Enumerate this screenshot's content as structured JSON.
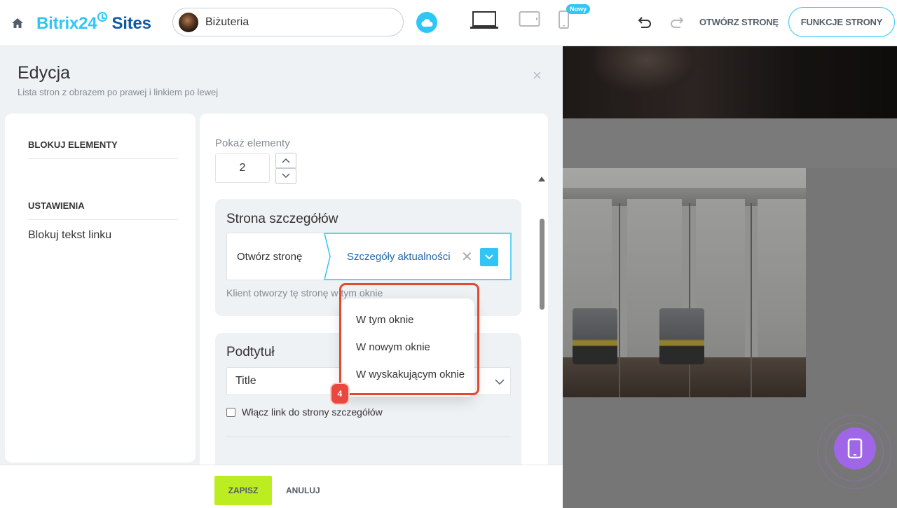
{
  "header": {
    "logo_part1": "Bitrix24",
    "logo_part2": "Sites",
    "site_name": "Biżuteria",
    "new_badge": "Nowy",
    "open_page": "OTWÓRZ STRONĘ",
    "page_functions": "FUNKCJE STRONY"
  },
  "panel": {
    "title": "Edycja",
    "subtitle": "Lista stron z obrazem po prawej i linkiem po lewej",
    "close": "×"
  },
  "sidebar": {
    "section1": "BLOKUJ ELEMENTY",
    "section2": "USTAWIENIA",
    "items": [
      {
        "label": "Blokuj tekst linku"
      }
    ]
  },
  "form": {
    "show_elements_label": "Pokaż elementy",
    "show_elements_value": "2",
    "detail_card": {
      "title": "Strona szczegółów",
      "action_label": "Otwórz stronę",
      "page_value": "Szczegóły aktualności",
      "hint": "Klient otworzy tę stronę w tym oknie"
    },
    "subtitle_card": {
      "title": "Podtytuł",
      "select_value": "Title",
      "checkbox_label": "Włącz link do strony szczegółów"
    }
  },
  "dropdown": {
    "options": [
      {
        "label": "W tym oknie"
      },
      {
        "label": "W nowym oknie"
      },
      {
        "label": "W wyskakującym oknie"
      }
    ]
  },
  "annotation": {
    "step_number": "4",
    "color": "#e04a2f"
  },
  "footer": {
    "save": "ZAPISZ",
    "cancel": "ANULUJ"
  },
  "colors": {
    "accent": "#2fc6f6",
    "brand_dark": "#0f58a8",
    "save_green": "#bbed21",
    "fab_purple": "#9f66e8"
  },
  "icons": {
    "home": "home-icon",
    "cloud": "cloud-icon",
    "desktop": "laptop-icon",
    "tablet": "tablet-icon",
    "mobile": "phone-icon",
    "undo": "undo-icon",
    "redo": "redo-icon",
    "fab": "tablet-icon"
  }
}
